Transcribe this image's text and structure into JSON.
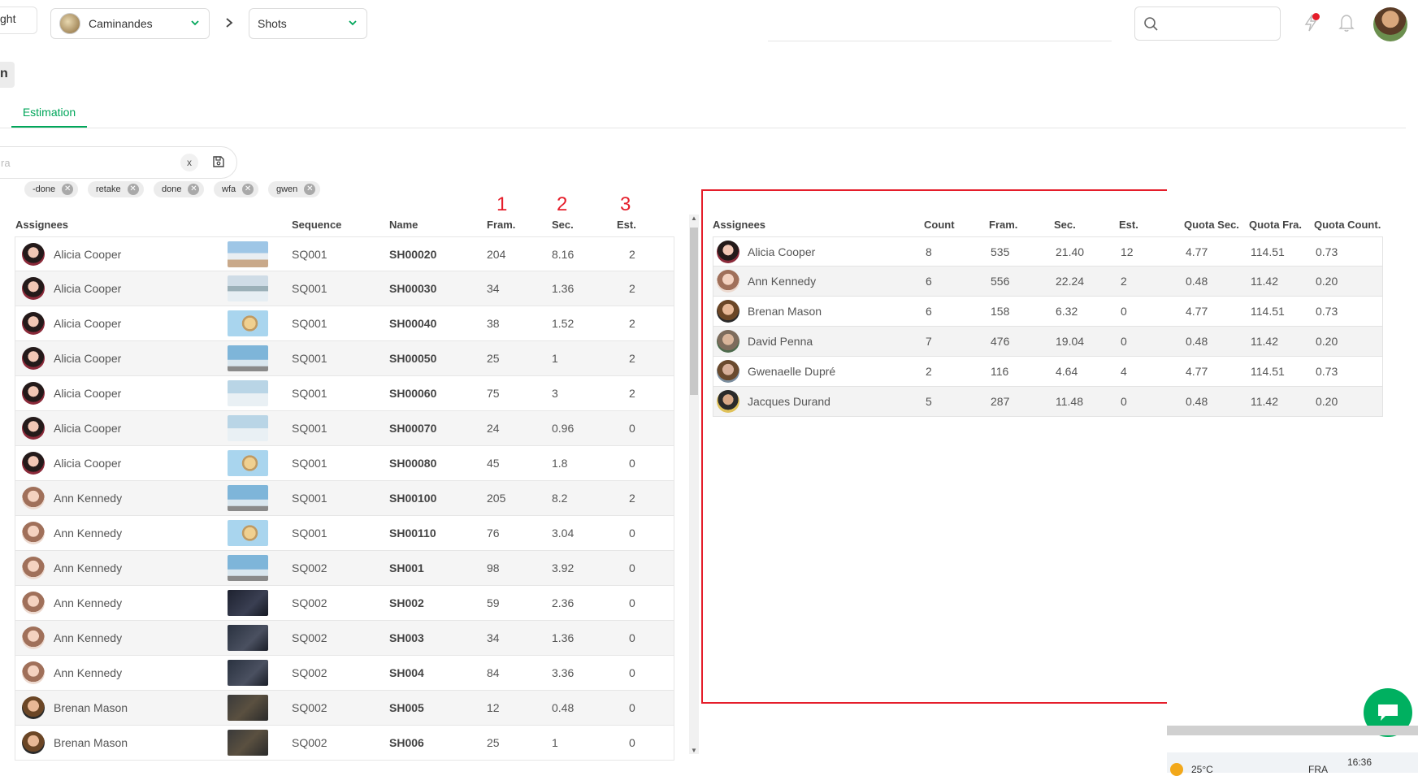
{
  "topbar": {
    "cut_input_value": "ght",
    "project_name": "Caminandes",
    "section_name": "Shots",
    "search_placeholder": ""
  },
  "side_button_label": "n",
  "tabs": {
    "active_label": "Estimation"
  },
  "filter": {
    "placeholder": "ra",
    "clear_label": "x",
    "chips": [
      "-done",
      "retake",
      "done",
      "wfa",
      "gwen"
    ]
  },
  "annotations": [
    "1",
    "2",
    "3"
  ],
  "left_table": {
    "headers": {
      "assignees": "Assignees",
      "sequence": "Sequence",
      "name": "Name",
      "frames": "Fram.",
      "seconds": "Sec.",
      "estimation": "Est."
    },
    "rows": [
      {
        "assignee": "Alicia Cooper",
        "sequence": "SQ001",
        "name": "SH00020",
        "frames": "204",
        "seconds": "8.16",
        "estimation": "2"
      },
      {
        "assignee": "Alicia Cooper",
        "sequence": "SQ001",
        "name": "SH00030",
        "frames": "34",
        "seconds": "1.36",
        "estimation": "2"
      },
      {
        "assignee": "Alicia Cooper",
        "sequence": "SQ001",
        "name": "SH00040",
        "frames": "38",
        "seconds": "1.52",
        "estimation": "2"
      },
      {
        "assignee": "Alicia Cooper",
        "sequence": "SQ001",
        "name": "SH00050",
        "frames": "25",
        "seconds": "1",
        "estimation": "2"
      },
      {
        "assignee": "Alicia Cooper",
        "sequence": "SQ001",
        "name": "SH00060",
        "frames": "75",
        "seconds": "3",
        "estimation": "2"
      },
      {
        "assignee": "Alicia Cooper",
        "sequence": "SQ001",
        "name": "SH00070",
        "frames": "24",
        "seconds": "0.96",
        "estimation": "0"
      },
      {
        "assignee": "Alicia Cooper",
        "sequence": "SQ001",
        "name": "SH00080",
        "frames": "45",
        "seconds": "1.8",
        "estimation": "0"
      },
      {
        "assignee": "Ann Kennedy",
        "sequence": "SQ001",
        "name": "SH00100",
        "frames": "205",
        "seconds": "8.2",
        "estimation": "2"
      },
      {
        "assignee": "Ann Kennedy",
        "sequence": "SQ001",
        "name": "SH00110",
        "frames": "76",
        "seconds": "3.04",
        "estimation": "0"
      },
      {
        "assignee": "Ann Kennedy",
        "sequence": "SQ002",
        "name": "SH001",
        "frames": "98",
        "seconds": "3.92",
        "estimation": "0"
      },
      {
        "assignee": "Ann Kennedy",
        "sequence": "SQ002",
        "name": "SH002",
        "frames": "59",
        "seconds": "2.36",
        "estimation": "0"
      },
      {
        "assignee": "Ann Kennedy",
        "sequence": "SQ002",
        "name": "SH003",
        "frames": "34",
        "seconds": "1.36",
        "estimation": "0"
      },
      {
        "assignee": "Ann Kennedy",
        "sequence": "SQ002",
        "name": "SH004",
        "frames": "84",
        "seconds": "3.36",
        "estimation": "0"
      },
      {
        "assignee": "Brenan Mason",
        "sequence": "SQ002",
        "name": "SH005",
        "frames": "12",
        "seconds": "0.48",
        "estimation": "0"
      },
      {
        "assignee": "Brenan Mason",
        "sequence": "SQ002",
        "name": "SH006",
        "frames": "25",
        "seconds": "1",
        "estimation": "0"
      }
    ]
  },
  "right_table": {
    "headers": {
      "assignees": "Assignees",
      "count": "Count",
      "frames": "Fram.",
      "seconds": "Sec.",
      "estimation": "Est.",
      "quota_sec": "Quota Sec.",
      "quota_fra": "Quota Fra.",
      "quota_count": "Quota Count."
    },
    "rows": [
      {
        "assignee": "Alicia Cooper",
        "count": "8",
        "frames": "535",
        "seconds": "21.40",
        "estimation": "12",
        "quota_sec": "4.77",
        "quota_fra": "114.51",
        "quota_count": "0.73"
      },
      {
        "assignee": "Ann Kennedy",
        "count": "6",
        "frames": "556",
        "seconds": "22.24",
        "estimation": "2",
        "quota_sec": "0.48",
        "quota_fra": "11.42",
        "quota_count": "0.20"
      },
      {
        "assignee": "Brenan Mason",
        "count": "6",
        "frames": "158",
        "seconds": "6.32",
        "estimation": "0",
        "quota_sec": "4.77",
        "quota_fra": "114.51",
        "quota_count": "0.73"
      },
      {
        "assignee": "David Penna",
        "count": "7",
        "frames": "476",
        "seconds": "19.04",
        "estimation": "0",
        "quota_sec": "0.48",
        "quota_fra": "11.42",
        "quota_count": "0.20"
      },
      {
        "assignee": "Gwenaelle Dupré",
        "count": "2",
        "frames": "116",
        "seconds": "4.64",
        "estimation": "4",
        "quota_sec": "4.77",
        "quota_fra": "114.51",
        "quota_count": "0.73"
      },
      {
        "assignee": "Jacques Durand",
        "count": "5",
        "frames": "287",
        "seconds": "11.48",
        "estimation": "0",
        "quota_sec": "0.48",
        "quota_fra": "11.42",
        "quota_count": "0.20"
      }
    ]
  },
  "taskbar": {
    "temperature": "25°C",
    "language": "FRA",
    "time": "16:36"
  },
  "colors": {
    "accent_green": "#00a65a",
    "annotation_red": "#e51d2a",
    "chat_green": "#00b060"
  }
}
